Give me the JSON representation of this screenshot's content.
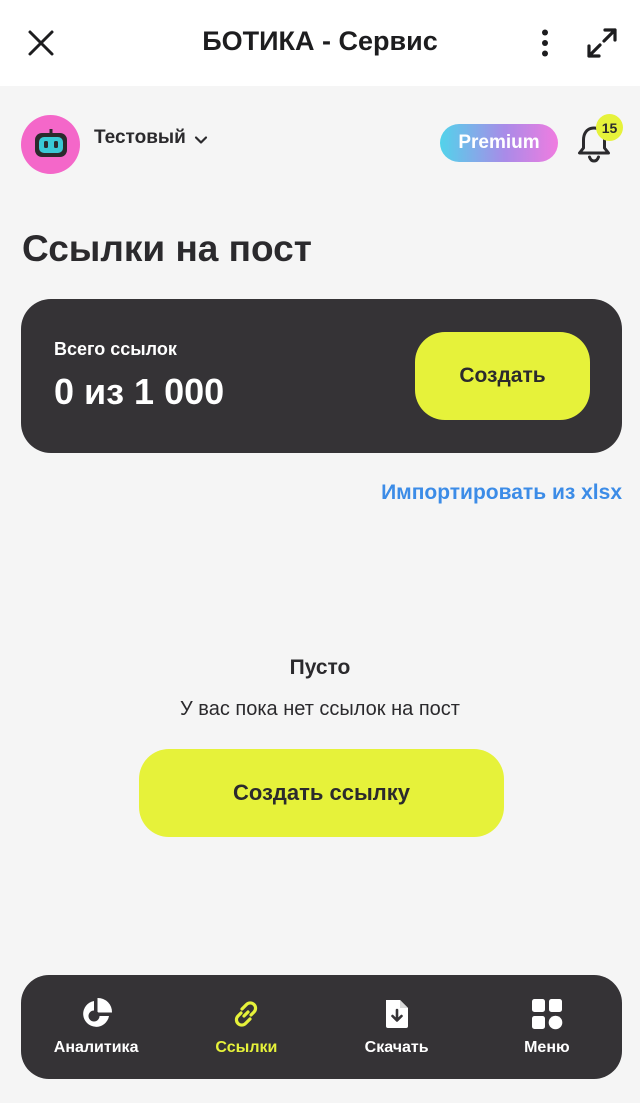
{
  "window": {
    "title": "БОТИКА - Сервис"
  },
  "account": {
    "name": "Тестовый",
    "premium_label": "Premium",
    "notifications_count": "15"
  },
  "page": {
    "title": "Ссылки на пост"
  },
  "stats": {
    "label": "Всего ссылок",
    "value": "0 из 1 000",
    "create_label": "Создать"
  },
  "import": {
    "label": "Импортировать из xlsx"
  },
  "empty_state": {
    "title": "Пусто",
    "text": "У вас пока нет ссылок на пост",
    "button_label": "Создать ссылку"
  },
  "nav": {
    "items": [
      {
        "label": "Аналитика",
        "icon": "pie-chart-icon",
        "active": false
      },
      {
        "label": "Ссылки",
        "icon": "link-icon",
        "active": true
      },
      {
        "label": "Скачать",
        "icon": "download-file-icon",
        "active": false
      },
      {
        "label": "Меню",
        "icon": "grid-menu-icon",
        "active": false
      }
    ]
  },
  "colors": {
    "accent": "#e6f23a",
    "dark": "#353336",
    "link": "#3c8ce7",
    "avatar": "#f467c9"
  }
}
